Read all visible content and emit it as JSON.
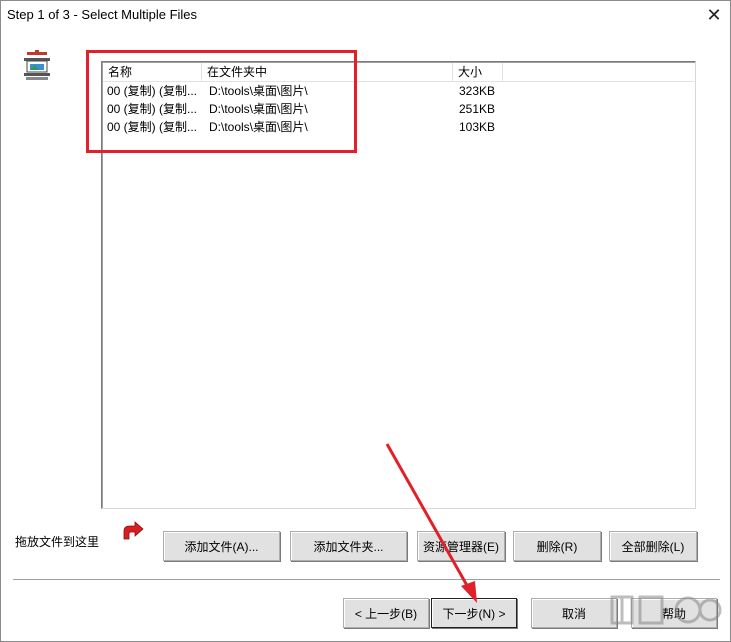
{
  "window": {
    "title": "Step 1 of 3 - Select Multiple Files",
    "close_glyph": "✕"
  },
  "icons": {
    "app": "file-stamp-icon",
    "drop_arrow": "curved-arrow-icon"
  },
  "file_list": {
    "columns": [
      "名称",
      "在文件夹中",
      "大小"
    ],
    "rows": [
      {
        "name": "00 (复制) (复制...",
        "folder": "D:\\tools\\桌面\\图片\\",
        "size": "323KB"
      },
      {
        "name": "00 (复制) (复制...",
        "folder": "D:\\tools\\桌面\\图片\\",
        "size": "251KB"
      },
      {
        "name": "00 (复制) (复制...",
        "folder": "D:\\tools\\桌面\\图片\\",
        "size": "103KB"
      }
    ]
  },
  "drop_label": "拖放文件到这里",
  "actions": {
    "add_file": "添加文件(A)...",
    "add_folder": "添加文件夹...",
    "explorer": "资源管理器(E)",
    "delete": "删除(R)",
    "delete_all": "全部删除(L)"
  },
  "wizard": {
    "back": "< 上一步(B)",
    "next": "下一步(N) >",
    "cancel": "取消",
    "help": "帮助"
  },
  "colors": {
    "annotation_red": "#e1202a",
    "button_face": "#e1e1e1"
  }
}
